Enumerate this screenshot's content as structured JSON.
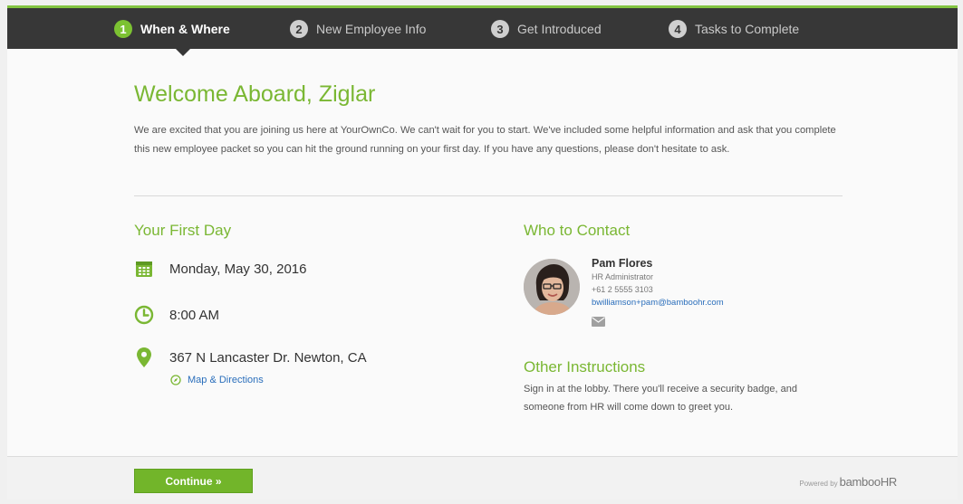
{
  "steps": [
    {
      "num": "1",
      "label": "When & Where"
    },
    {
      "num": "2",
      "label": "New Employee Info"
    },
    {
      "num": "3",
      "label": "Get Introduced"
    },
    {
      "num": "4",
      "label": "Tasks to Complete"
    }
  ],
  "welcome": {
    "title": "Welcome Aboard, Ziglar",
    "intro": "We are excited that you are joining us here at YourOwnCo. We can't wait for you to start. We've included some helpful information and ask that you complete this new employee packet so you can hit the ground running on your first day. If you have any questions, please don't hesitate to ask."
  },
  "first_day": {
    "heading": "Your First Day",
    "date": "Monday, May 30, 2016",
    "time": "8:00 AM",
    "address": "367 N Lancaster Dr. Newton, CA",
    "map_link": "Map & Directions"
  },
  "contact": {
    "heading": "Who to Contact",
    "name": "Pam Flores",
    "role": "HR Administrator",
    "phone": "+61 2 5555 3103",
    "email": "bwilliamson+pam@bamboohr.com"
  },
  "other": {
    "heading": "Other Instructions",
    "text": "Sign in at the lobby. There you'll receive a security badge, and someone from HR will come down to greet you."
  },
  "footer": {
    "continue_label": "Continue »",
    "powered_by": "Powered by",
    "brand": "bambooHR"
  },
  "colors": {
    "accent": "#7ab733",
    "stepbar": "#373737",
    "link": "#2a6ebb"
  },
  "icons": [
    "calendar-icon",
    "clock-icon",
    "map-pin-icon",
    "compass-icon",
    "mail-icon"
  ]
}
